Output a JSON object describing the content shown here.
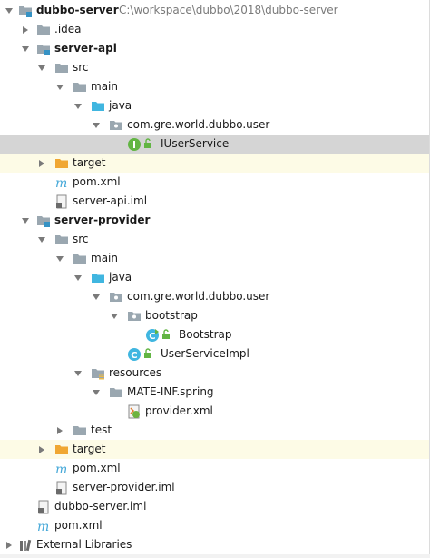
{
  "project_tree": {
    "root": {
      "name": "dubbo-server",
      "path": "C:\\workspace\\dubbo\\2018\\dubbo-server"
    },
    "idea": ".idea",
    "api": {
      "name": "server-api",
      "src": "src",
      "main": "main",
      "java": "java",
      "package": "com.gre.world.dubbo.user",
      "interface": "IUserService",
      "target": "target",
      "pom": "pom.xml",
      "iml": "server-api.iml"
    },
    "provider": {
      "name": "server-provider",
      "src": "src",
      "main": "main",
      "java": "java",
      "package": "com.gre.world.dubbo.user",
      "bootstrap_pkg": "bootstrap",
      "bootstrap_class": "Bootstrap",
      "impl_class": "UserServiceImpl",
      "resources": "resources",
      "meta": "MATE-INF.spring",
      "provider_xml": "provider.xml",
      "test": "test",
      "target": "target",
      "pom": "pom.xml",
      "iml": "server-provider.iml"
    },
    "root_iml": "dubbo-server.iml",
    "root_pom": "pom.xml",
    "external_libraries": "External Libraries"
  },
  "colors": {
    "selection": "#d5d5d5",
    "excluded": "#fdfbe6",
    "folder": "#9aa7b0",
    "source_folder": "#40b6e0",
    "module_marker": "#3592c4",
    "target_folder": "#f0a732",
    "interface_icon": "#62b543",
    "class_icon": "#40b6e0",
    "maven_icon": "#45a8d8",
    "resources_marker": "#e6b94e"
  },
  "icon_names": [
    "folder-icon",
    "module-folder-icon",
    "source-folder-icon",
    "package-icon",
    "interface-icon",
    "class-icon",
    "target-folder-icon",
    "maven-pom-icon",
    "iml-file-icon",
    "resources-folder-icon",
    "spring-xml-icon",
    "libraries-icon",
    "lock-icon",
    "chevron-down-icon",
    "chevron-right-icon"
  ]
}
